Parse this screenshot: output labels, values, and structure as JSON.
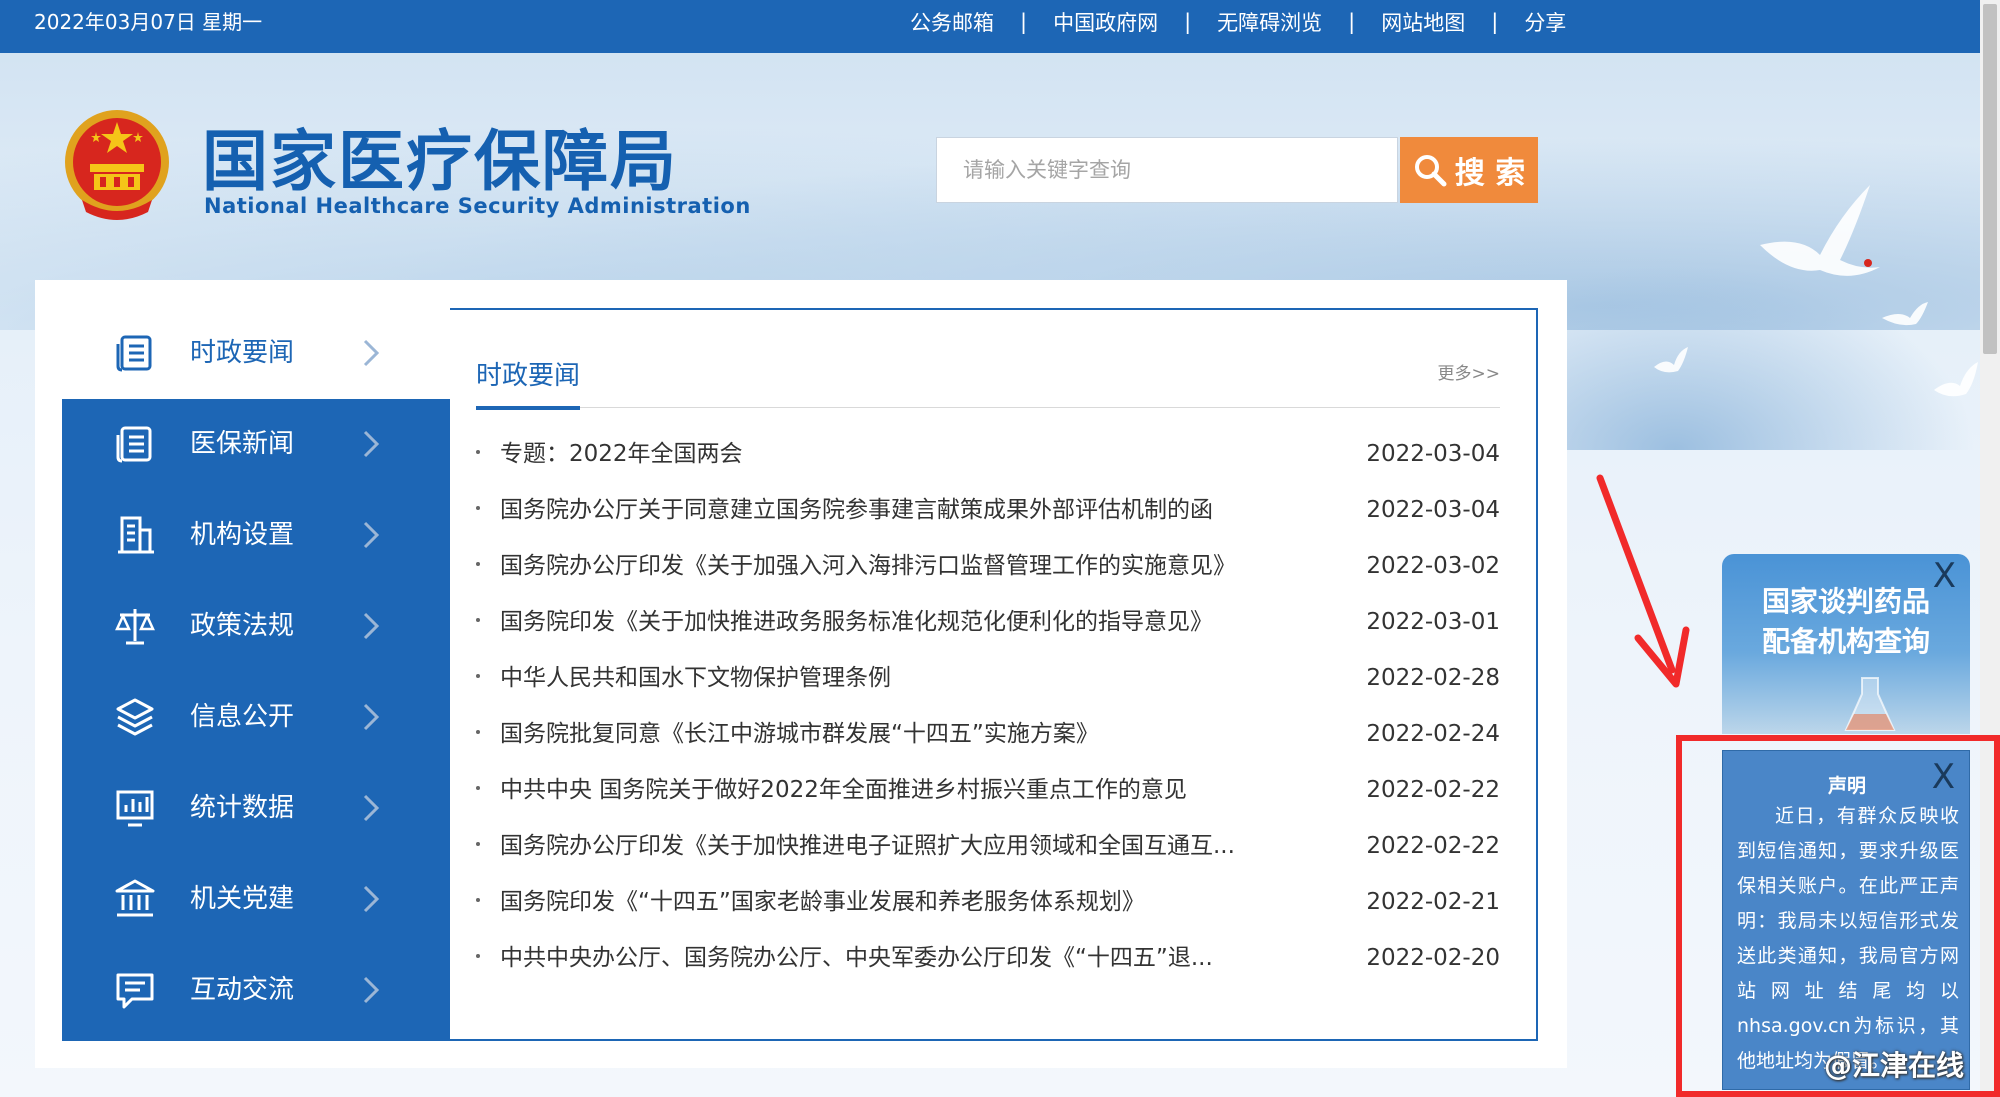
{
  "topbar": {
    "date": "2022年03月07日 星期一",
    "links": [
      "公务邮箱",
      "中国政府网",
      "无障碍浏览",
      "网站地图",
      "分享"
    ],
    "separator": "|"
  },
  "logo": {
    "cn": "国家医疗保障局",
    "en": "National Healthcare Security Administration"
  },
  "search": {
    "placeholder": "请输入关键字查询",
    "button": "搜 索"
  },
  "sidebar": {
    "items": [
      {
        "label": "时政要闻",
        "icon": "news-document-icon",
        "active": true
      },
      {
        "label": "医保新闻",
        "icon": "newspaper-icon",
        "active": false
      },
      {
        "label": "机构设置",
        "icon": "building-icon",
        "active": false
      },
      {
        "label": "政策法规",
        "icon": "scales-icon",
        "active": false
      },
      {
        "label": "信息公开",
        "icon": "layers-icon",
        "active": false
      },
      {
        "label": "统计数据",
        "icon": "chart-monitor-icon",
        "active": false
      },
      {
        "label": "机关党建",
        "icon": "institution-icon",
        "active": false
      },
      {
        "label": "互动交流",
        "icon": "chat-icon",
        "active": false
      }
    ]
  },
  "main": {
    "title": "时政要闻",
    "more": "更多>>",
    "news": [
      {
        "title": "专题：2022年全国两会",
        "date": "2022-03-04"
      },
      {
        "title": "国务院办公厅关于同意建立国务院参事建言献策成果外部评估机制的函",
        "date": "2022-03-04"
      },
      {
        "title": "国务院办公厅印发《关于加强入河入海排污口监督管理工作的实施意见》",
        "date": "2022-03-02"
      },
      {
        "title": "国务院印发《关于加快推进政务服务标准化规范化便利化的指导意见》",
        "date": "2022-03-01"
      },
      {
        "title": "中华人民共和国水下文物保护管理条例",
        "date": "2022-02-28"
      },
      {
        "title": "国务院批复同意《长江中游城市群发展“十四五”实施方案》",
        "date": "2022-02-24"
      },
      {
        "title": "中共中央 国务院关于做好2022年全面推进乡村振兴重点工作的意见",
        "date": "2022-02-22"
      },
      {
        "title": "国务院办公厅印发《关于加快推进电子证照扩大应用领域和全国互通互...",
        "date": "2022-02-22"
      },
      {
        "title": "国务院印发《“十四五”国家老龄事业发展和养老服务体系规划》",
        "date": "2022-02-21"
      },
      {
        "title": "中共中央办公厅、国务院办公厅、中央军委办公厅印发《“十四五”退...",
        "date": "2022-02-20"
      }
    ]
  },
  "floating": {
    "drug_query": {
      "line1": "国家谈判药品",
      "line2": "配备机构查询",
      "close": "X"
    },
    "notice": {
      "title": "声明",
      "close": "X",
      "body": "近日，有群众反映收到短信通知，要求升级医保相关账户。在此严正声明：我局未以短信形式发送此类通知，我局官方网站网址结尾均以nhsa.gov.cn为标识，其他地址均为假冒。"
    }
  },
  "watermark": "@江津在线",
  "colors": {
    "brand_blue": "#1d66b5",
    "search_orange": "#f08a3c",
    "highlight_red": "#f12a2a"
  }
}
